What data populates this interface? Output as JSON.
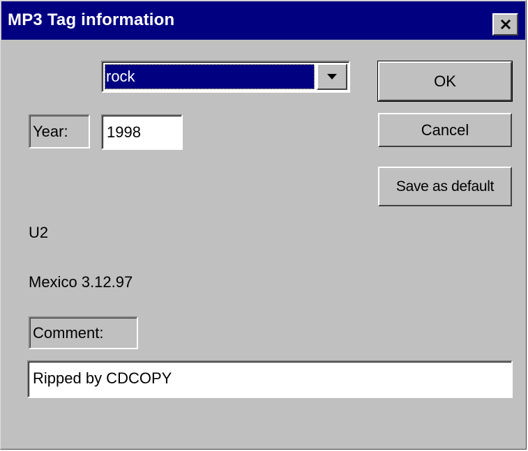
{
  "window": {
    "title": "MP3 Tag information",
    "colors": {
      "face": "#c0c0c0",
      "titlebar": "#000080",
      "selection": "#000080"
    }
  },
  "genre": {
    "selected": "rock"
  },
  "year": {
    "label": "Year:",
    "value": "1998"
  },
  "artist": "U2",
  "album": "Mexico 3.12.97",
  "comment": {
    "label": "Comment:",
    "value": "Ripped by CDCOPY"
  },
  "buttons": {
    "ok": "OK",
    "cancel": "Cancel",
    "save_default": "Save as default"
  },
  "icons": {
    "close": "close-x-icon",
    "dropdown_arrow": "triangle-down-icon"
  }
}
